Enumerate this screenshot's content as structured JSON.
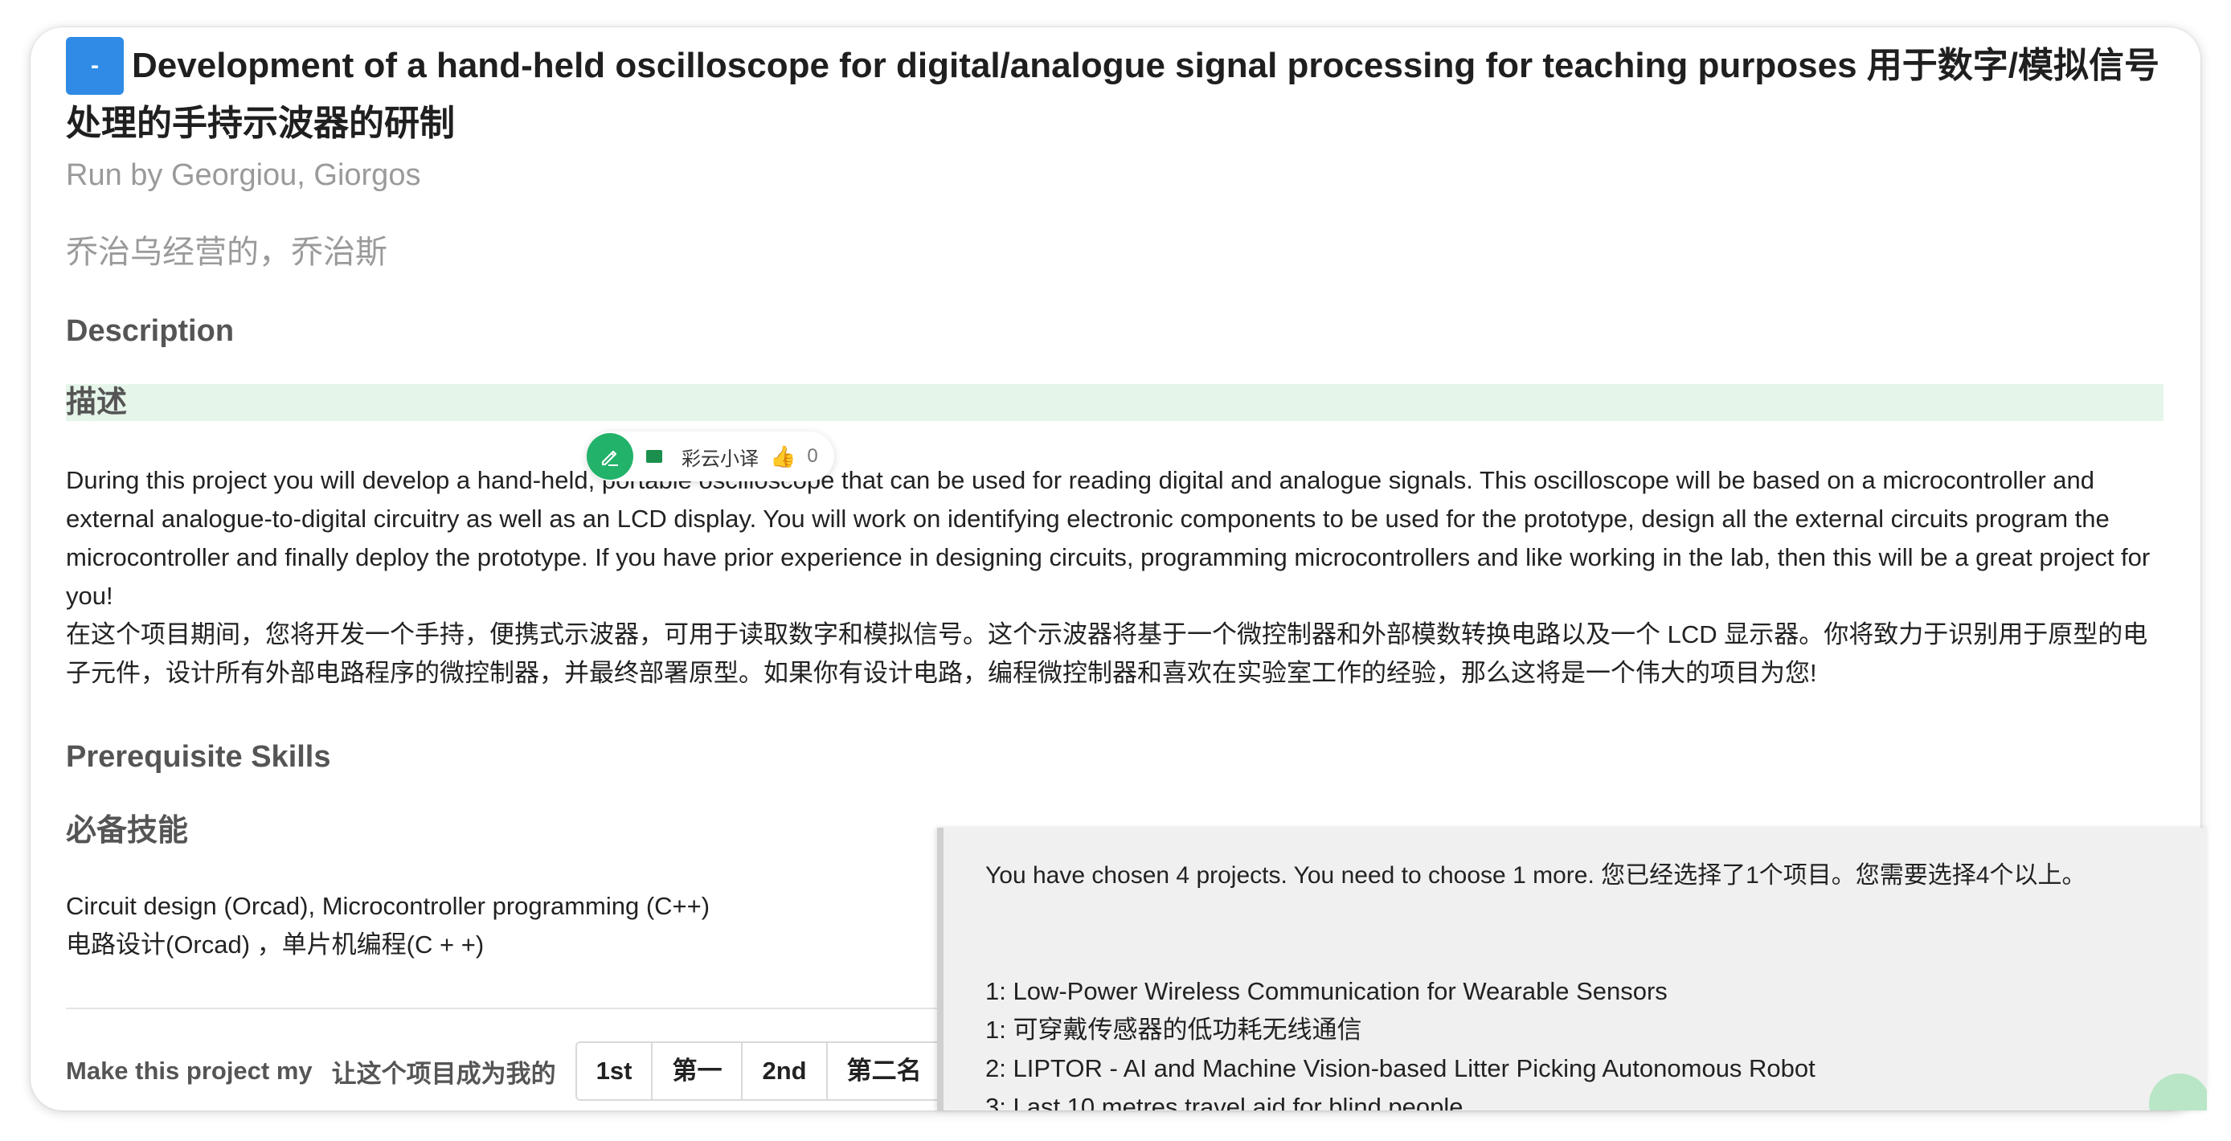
{
  "project": {
    "button_label": "-",
    "title": "Development of a hand-held oscilloscope for digital/analogue signal processing for teaching purposes   用于数字/模拟信号处理的手持示波器的研制",
    "run_by": "Run by Georgiou, Giorgos",
    "run_by_cn": "乔治乌经营的，乔治斯"
  },
  "description": {
    "heading": "Description",
    "heading_cn": "描述",
    "text_en": "During this project you will develop a hand-held, portable oscilloscope that can be used for reading digital and analogue signals. This oscilloscope will be based on a microcontroller and external analogue-to-digital circuitry as well as an LCD display. You will work on identifying electronic components to be used for the prototype, design all the external circuits program the microcontroller and finally deploy the prototype. If you have prior experience in designing circuits, programming microcontrollers and like working in the lab, then this will be a great project for you!",
    "text_cn": "在这个项目期间，您将开发一个手持，便携式示波器，可用于读取数字和模拟信号。这个示波器将基于一个微控制器和外部模数转换电路以及一个 LCD 显示器。你将致力于识别用于原型的电子元件，设计所有外部电路程序的微控制器，并最终部署原型。如果你有设计电路，编程微控制器和喜欢在实验室工作的经验，那么这将是一个伟大的项目为您!"
  },
  "skills": {
    "heading": "Prerequisite Skills",
    "heading_cn": "必备技能",
    "text_en": "Circuit design (Orcad), Microcontroller programming (C++)",
    "text_cn": "电路设计(Orcad) ，单片机编程(C + +)"
  },
  "choose": {
    "label": "Make this project my",
    "label_cn": "让这个项目成为我的",
    "options": [
      "1st",
      "第一",
      "2nd",
      "第二名"
    ]
  },
  "translator": {
    "label": "彩云小译",
    "likes": "0"
  },
  "selection": {
    "message": "You have chosen 4 projects. You need to choose 1 more.   您已经选择了1个项目。您需要选择4个以上。",
    "items": [
      "1: Low-Power Wireless Communication for Wearable Sensors",
      "1: 可穿戴传感器的低功耗无线通信",
      "2: LIPTOR - AI and Machine Vision-based Litter Picking Autonomous Robot",
      "3: Last 10 metres travel aid for blind people"
    ]
  }
}
